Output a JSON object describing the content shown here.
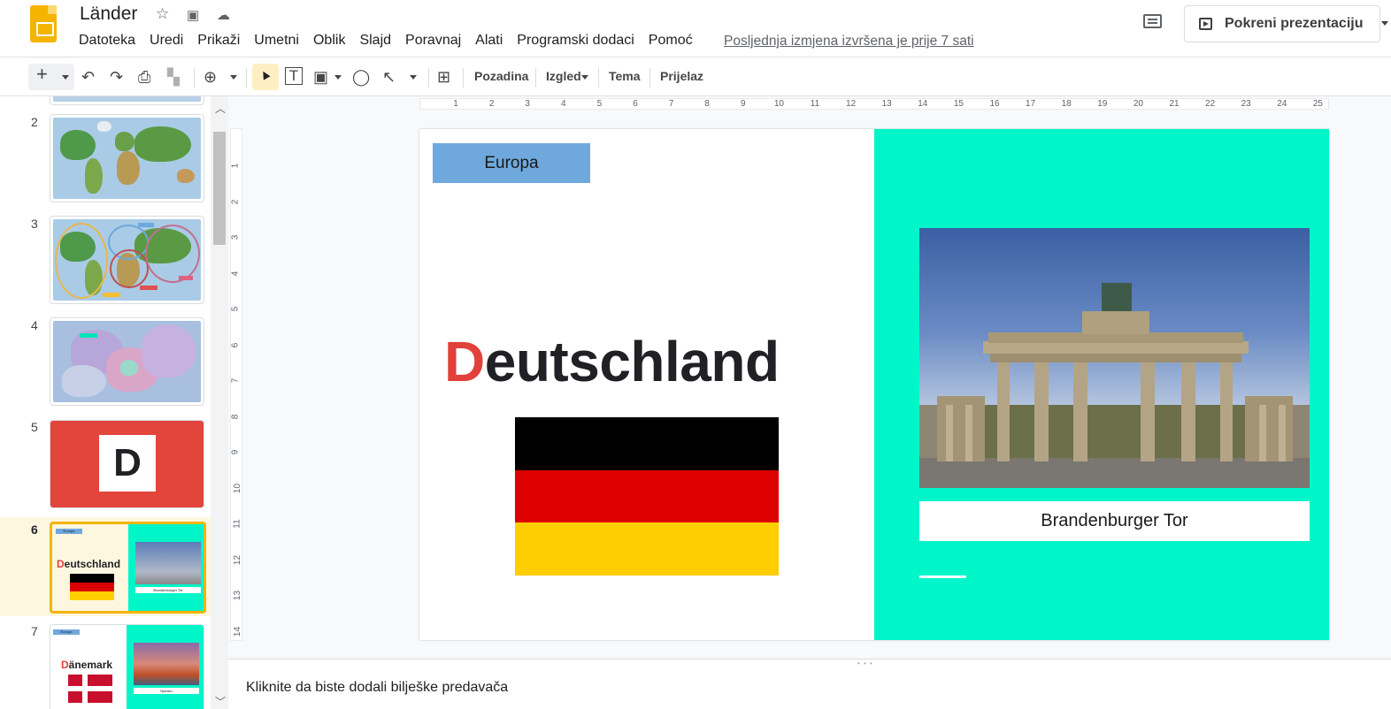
{
  "app": {
    "title": "Länder",
    "menu": [
      "Datoteka",
      "Uredi",
      "Prikaži",
      "Umetni",
      "Oblik",
      "Slajd",
      "Poravnaj",
      "Alati",
      "Programski dodaci",
      "Pomoć"
    ],
    "last_edit": "Posljednja izmjena izvršena je prije 7 sati",
    "present_label": "Pokreni prezentaciju"
  },
  "toolbar": {
    "background": "Pozadina",
    "layout": "Izgled",
    "theme": "Tema",
    "transition": "Prijelaz"
  },
  "filmstrip": {
    "slides": [
      {
        "num": "2",
        "kind": "world-map"
      },
      {
        "num": "3",
        "kind": "world-map-circles",
        "labels": [
          "Europa",
          "Afrika",
          "Amerika",
          "Asien"
        ]
      },
      {
        "num": "4",
        "kind": "europe-map",
        "labels": [
          "Deutschland"
        ]
      },
      {
        "num": "5",
        "kind": "letter",
        "letter": "D"
      },
      {
        "num": "6",
        "kind": "country",
        "tag": "Europa",
        "first": "D",
        "rest": "eutschland",
        "caption": "Brandenburger Tor",
        "active": true
      },
      {
        "num": "7",
        "kind": "country",
        "tag": "Europa",
        "first": "D",
        "rest": "änemark",
        "caption": "Nyhavn"
      }
    ]
  },
  "rulers": {
    "h": [
      "1",
      "2",
      "3",
      "4",
      "5",
      "6",
      "7",
      "8",
      "9",
      "10",
      "11",
      "12",
      "13",
      "14",
      "15",
      "16",
      "17",
      "18",
      "19",
      "20",
      "21",
      "22",
      "23",
      "24",
      "25"
    ],
    "v": [
      "1",
      "2",
      "3",
      "4",
      "5",
      "6",
      "7",
      "8",
      "9",
      "10",
      "11",
      "12",
      "13",
      "14"
    ]
  },
  "slide": {
    "tag": "Europa",
    "country_first": "D",
    "country_rest": "eutschland",
    "caption": "Brandenburger Tor",
    "colors": {
      "accent_panel": "#00f5c8",
      "tag_box": "#6fa8dc",
      "first_letter": "#e2403a",
      "flag": [
        "#000000",
        "#dd0000",
        "#ffce00"
      ]
    }
  },
  "notes": {
    "placeholder": "Kliknite da biste dodali bilješke predavača"
  }
}
